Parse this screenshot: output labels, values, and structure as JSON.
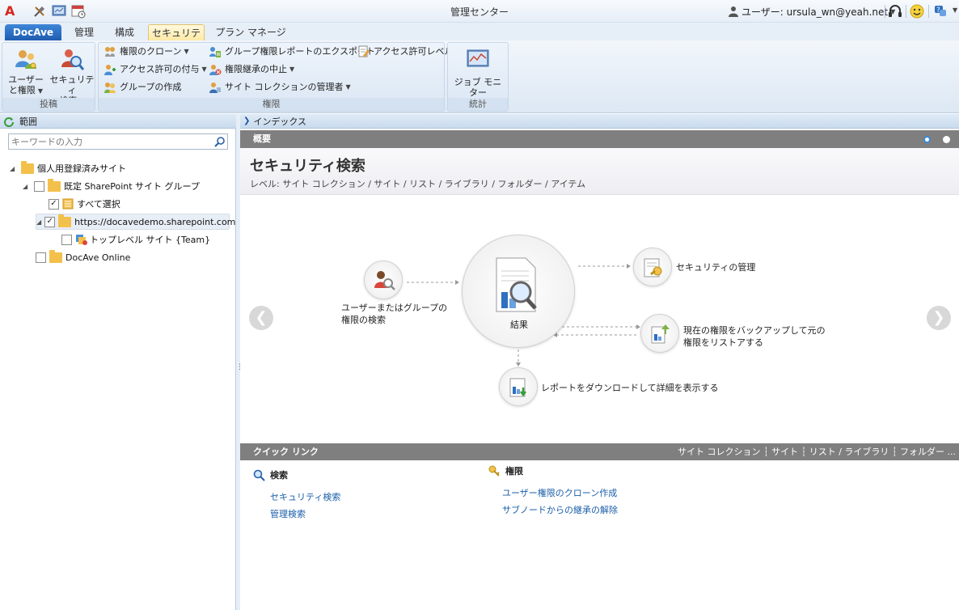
{
  "window": {
    "title": "管理センター"
  },
  "user": {
    "label": "ユーザー: ursula_wn@yeah.net"
  },
  "tabs": {
    "docave": "DocAve",
    "manage": "管理",
    "config": "構成",
    "security": "セキュリティ",
    "plan": "プラン マネージャー"
  },
  "ribbon": {
    "post": {
      "label": "投稿",
      "user_perm": [
        "ユーザー",
        "と権限"
      ],
      "sec_search": [
        "セキュリティ",
        "検索"
      ]
    },
    "perm": {
      "label": "権限",
      "clone": "権限のクローン",
      "grant": "アクセス許可の付与",
      "create_group": "グループの作成",
      "export": "グループ権限レポートのエクスポート",
      "stop_inherit": "権限継承の中止",
      "site_admin": "サイト コレクションの管理者",
      "access_level": "アクセス許可レベル"
    },
    "stats": {
      "label": "統計",
      "job_monitor": "ジョブ モニター"
    }
  },
  "left": {
    "header": "範囲",
    "search_placeholder": "キーワードの入力",
    "tree": {
      "root": "個人用登録済みサイト",
      "group": "既定 SharePoint サイト グループ",
      "select_all": "すべて選択",
      "url": "https://docavedemo.sharepoint.com",
      "toplevel": "トップレベル サイト {Team}",
      "online": "DocAve Online"
    }
  },
  "crumb": "インデックス",
  "overview": {
    "header": "概要",
    "title": "セキュリティ検索",
    "levels": "レベル: サイト コレクション / サイト / リスト / ライブラリ / フォルダー / アイテム"
  },
  "diagram": {
    "search_label": [
      "ユーザーまたはグループの",
      "権限の検索"
    ],
    "result_label": "結果",
    "manage_label": "セキュリティの管理",
    "backup_label": [
      "現在の権限をバックアップして元の",
      "権限をリストアする"
    ],
    "download_label": "レポートをダウンロードして詳細を表示する"
  },
  "quicklinks": {
    "header": "クイック リンク",
    "filters": "サイト コレクション ┆ サイト ┆ リスト / ライブラリ ┆ フォルダー ...",
    "search_head": "検索",
    "search_links": [
      "セキュリティ検索",
      "管理検索"
    ],
    "perm_head": "権限",
    "perm_links": [
      "ユーザー権限のクローン作成",
      "サブノードからの継承の解除"
    ]
  },
  "colors": {
    "accent": "#1f5cb0",
    "tab_active": "#ffe9a6",
    "link": "#1a5ea8",
    "section_header": "#7f7f7f"
  }
}
